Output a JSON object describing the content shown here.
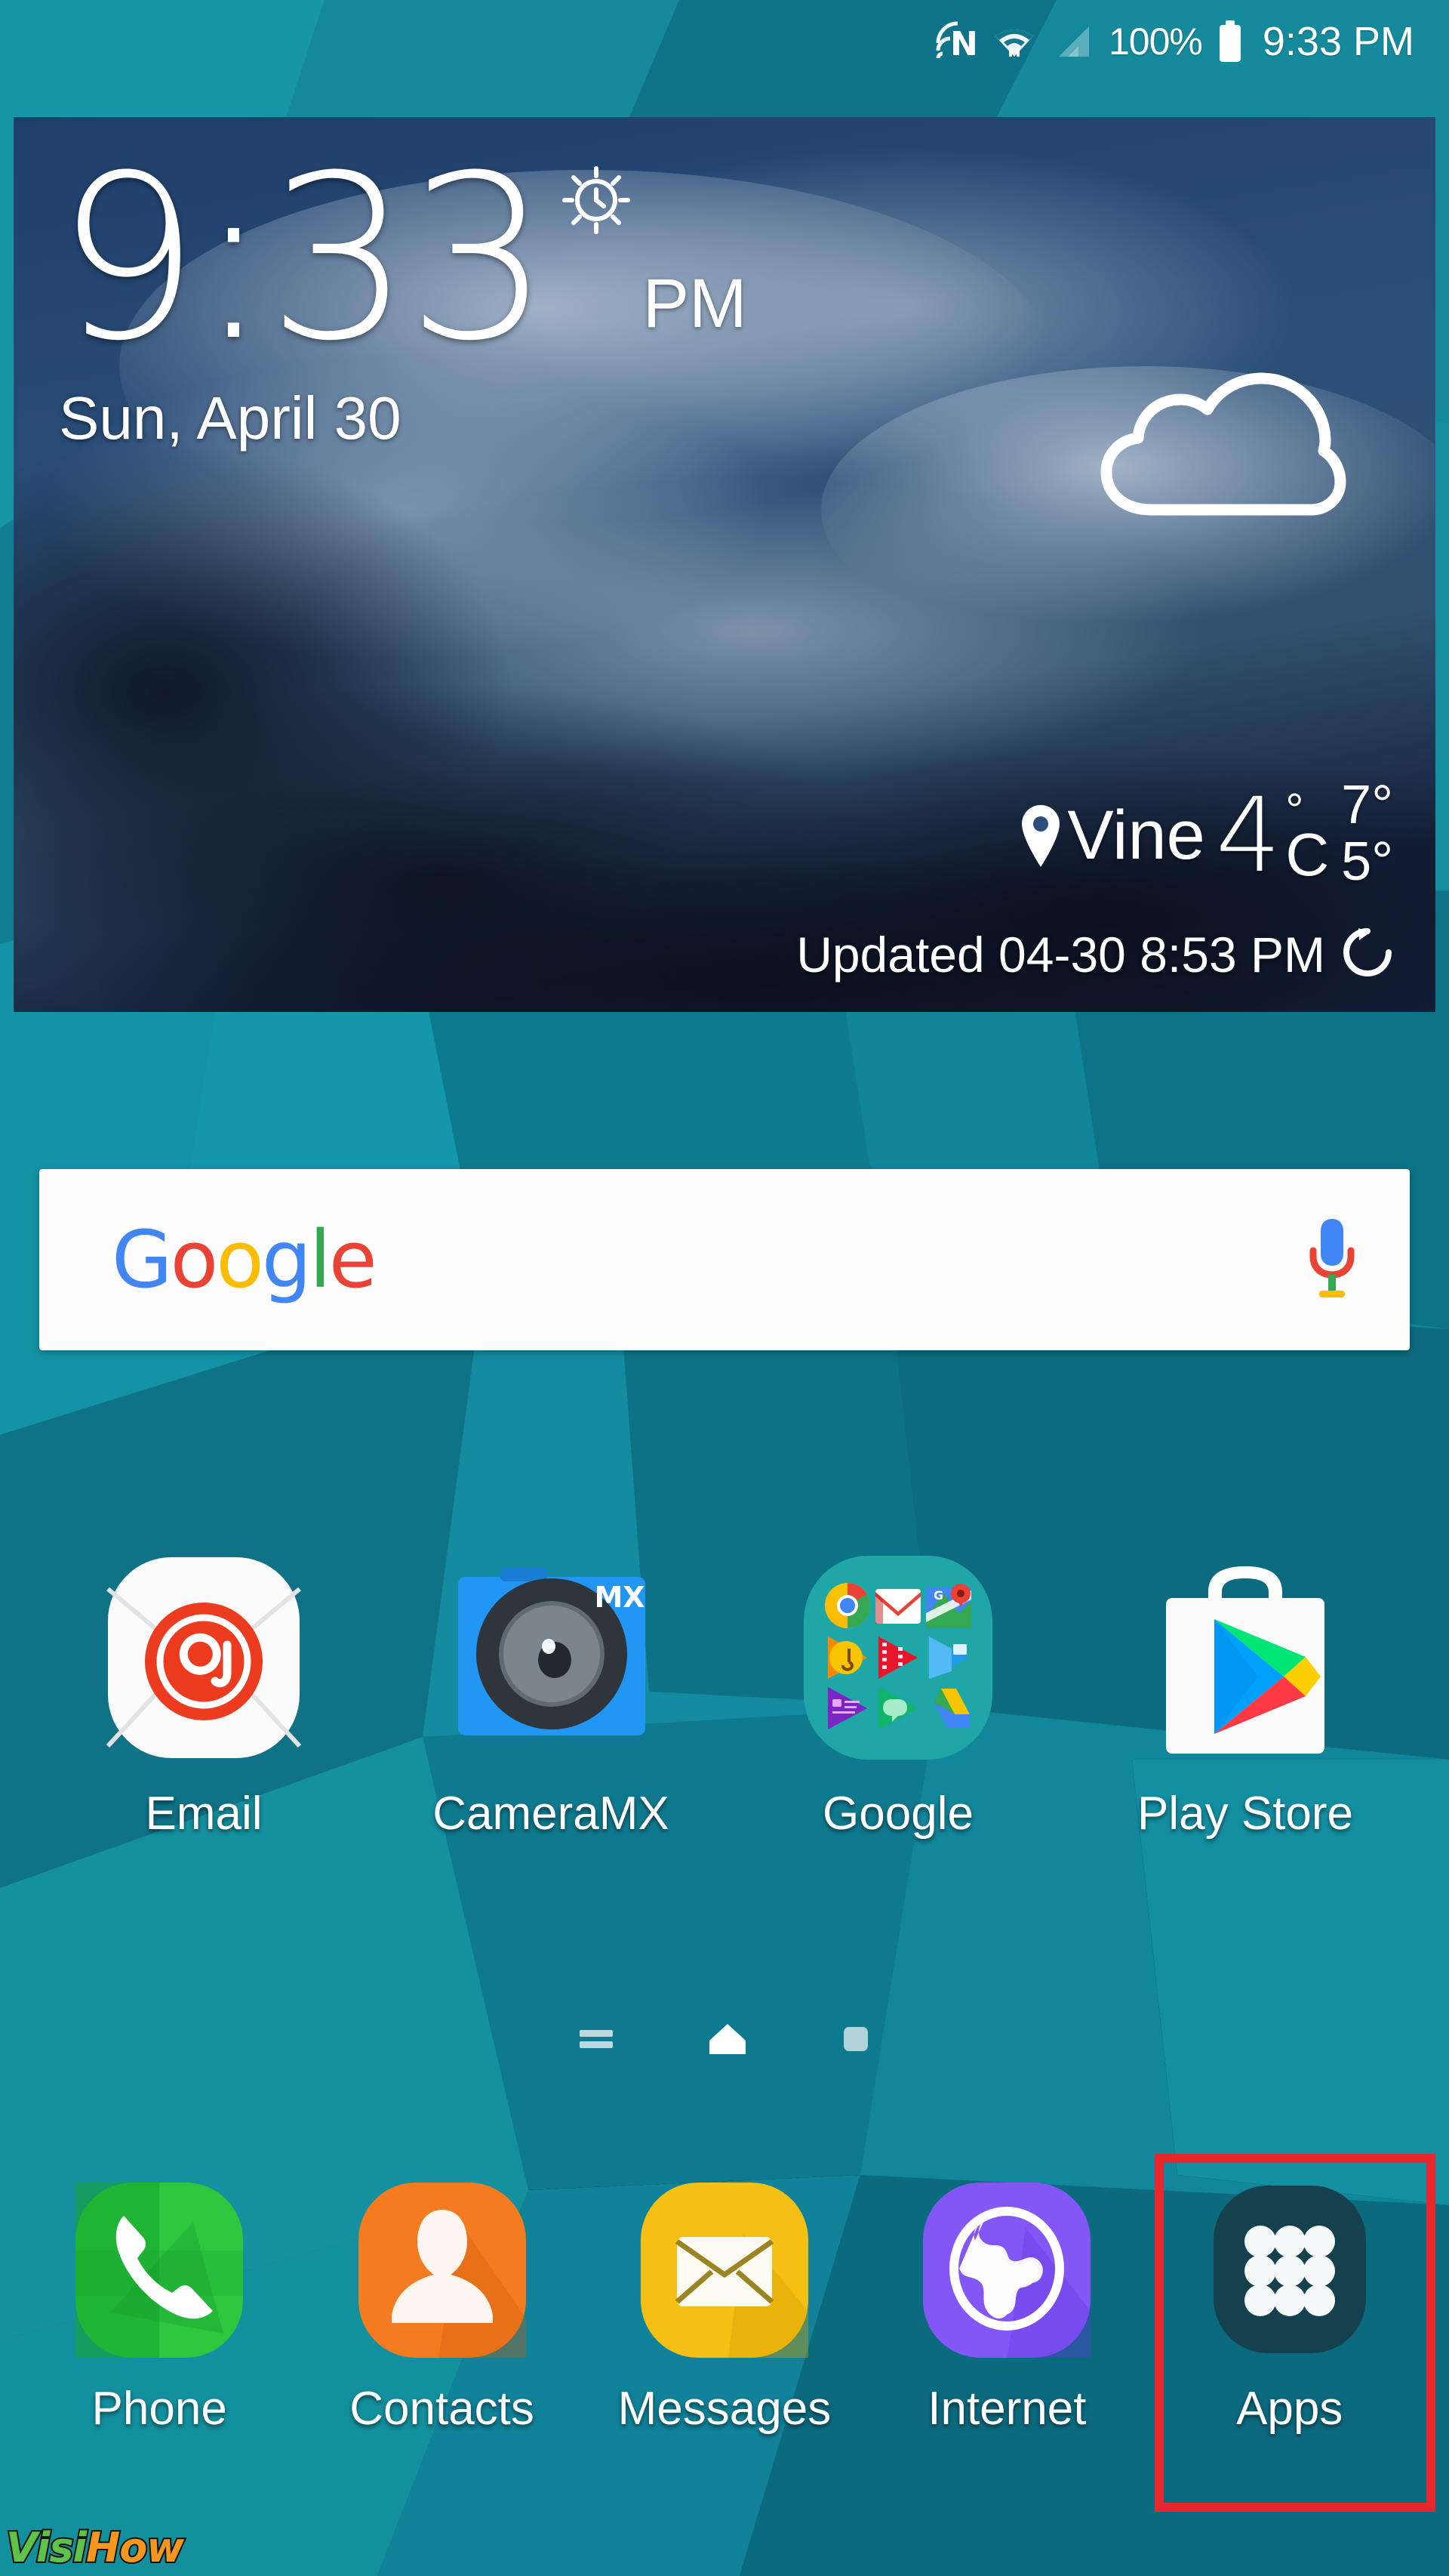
{
  "status_bar": {
    "nfc_icon": "nfc-icon",
    "wifi_icon": "wifi-icon",
    "signal_icon": "cellular-signal-icon",
    "battery_percent": "100%",
    "battery_icon": "battery-full-icon",
    "clock": "9:33 PM"
  },
  "weather_widget": {
    "time": "9:33",
    "ampm": "PM",
    "alarm_icon": "alarm-clock-icon",
    "date": "Sun, April 30",
    "condition_icon": "cloudy-icon",
    "location_pin_icon": "location-pin-icon",
    "city": "Vine",
    "temperature": "4",
    "degree_symbol": "°",
    "unit": "C",
    "high": "7°",
    "low": "5°",
    "updated_text": "Updated 04-30 8:53 PM",
    "refresh_icon": "refresh-icon"
  },
  "search": {
    "logo_letters": [
      {
        "char": "G",
        "color": "#4285F4"
      },
      {
        "char": "o",
        "color": "#EA4335"
      },
      {
        "char": "o",
        "color": "#FBBC05"
      },
      {
        "char": "g",
        "color": "#4285F4"
      },
      {
        "char": "l",
        "color": "#34A853"
      },
      {
        "char": "e",
        "color": "#EA4335"
      }
    ],
    "logo_text": "Google",
    "mic_icon": "microphone-icon",
    "placeholder": ""
  },
  "app_grid": [
    {
      "label": "Email",
      "icon": "email-icon"
    },
    {
      "label": "CameraMX",
      "icon": "camera-mx-icon",
      "badge": "MX"
    },
    {
      "label": "Google",
      "icon": "google-folder-icon"
    },
    {
      "label": "Play Store",
      "icon": "play-store-icon"
    }
  ],
  "google_folder_apps": [
    "chrome-icon",
    "gmail-icon",
    "maps-icon",
    "play-music-icon",
    "play-movies-icon",
    "play-books-icon",
    "play-newsstand-icon",
    "hangouts-icon",
    "drive-icon"
  ],
  "page_indicator": {
    "items": [
      {
        "icon": "briefing-page-icon",
        "active": false
      },
      {
        "icon": "home-page-icon",
        "active": true
      },
      {
        "icon": "page-dot-icon",
        "active": false
      }
    ]
  },
  "dock": [
    {
      "label": "Phone",
      "icon": "phone-icon",
      "highlighted": false
    },
    {
      "label": "Contacts",
      "icon": "contacts-icon",
      "highlighted": false
    },
    {
      "label": "Messages",
      "icon": "messages-icon",
      "highlighted": false
    },
    {
      "label": "Internet",
      "icon": "internet-icon",
      "highlighted": false
    },
    {
      "label": "Apps",
      "icon": "apps-grid-icon",
      "highlighted": true
    }
  ],
  "highlight": {
    "target": "Apps",
    "color": "#e8272c"
  },
  "watermark": {
    "part1": "Visi",
    "part2": "How",
    "color1": "#5fc24a",
    "color2": "#f5961e"
  },
  "colors": {
    "wallpaper_base": "#10788f",
    "accent_red": "#e8272c",
    "widget_sky": "#1d3a63"
  }
}
